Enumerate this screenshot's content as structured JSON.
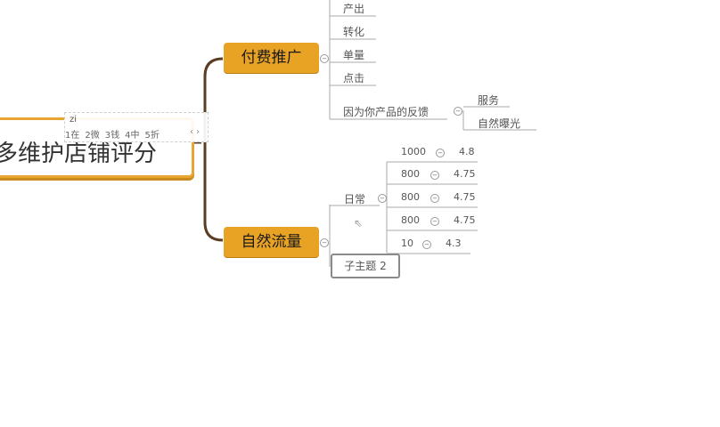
{
  "root": {
    "text": "多维护店铺评分"
  },
  "ime": {
    "input": "zi",
    "candidates": [
      "1在",
      "2微",
      "3钱",
      "4中",
      "5折"
    ],
    "nav": "‹ ›"
  },
  "paid": {
    "label": "付费推广",
    "children": [
      "产出",
      "转化",
      "单量",
      "点击",
      "因为你产品的反馈"
    ],
    "feedback_children": [
      "服务",
      "自然曝光"
    ]
  },
  "natural": {
    "label": "自然流量",
    "daily": {
      "label": "日常",
      "rows": [
        {
          "count": "1000",
          "score": "4.8"
        },
        {
          "count": "800",
          "score": "4.75"
        },
        {
          "count": "800",
          "score": "4.75"
        },
        {
          "count": "800",
          "score": "4.75"
        },
        {
          "count": "10",
          "score": "4.3"
        }
      ]
    },
    "subtopic": "子主题 2"
  },
  "colors": {
    "main_node": "#e8a224",
    "branch": "#5a3e24",
    "line": "#aaaaaa"
  }
}
